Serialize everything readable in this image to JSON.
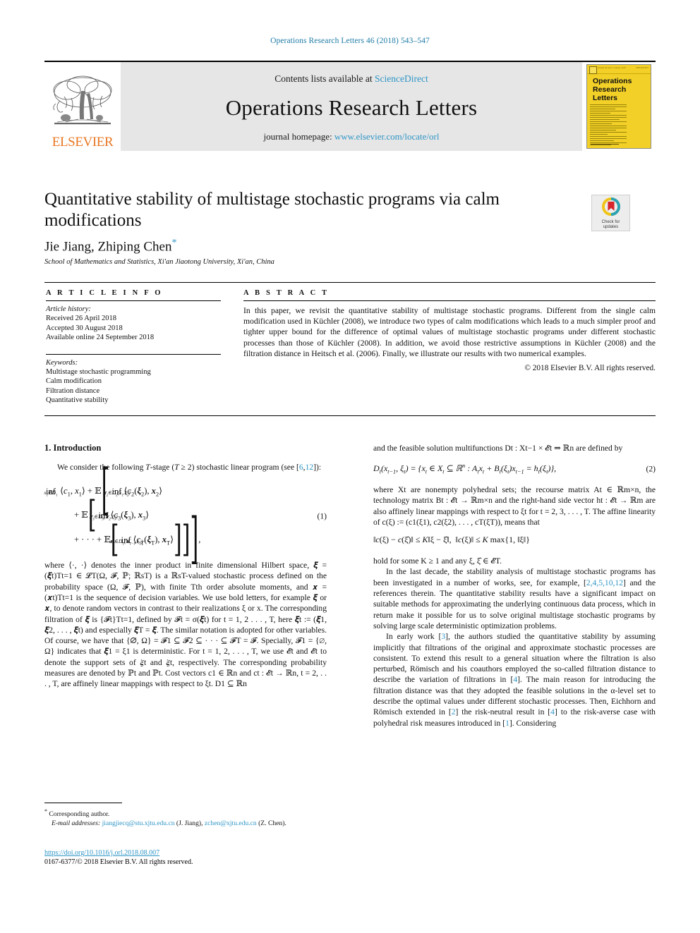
{
  "running_head": "Operations Research Letters 46 (2018) 543–547",
  "masthead": {
    "contents_prefix": "Contents lists available at ",
    "sciencedirect": "ScienceDirect",
    "journal_name": "Operations Research Letters",
    "homepage_prefix": "journal homepage: ",
    "homepage_url": "www.elsevier.com/locate/orl",
    "publisher": "ELSEVIER",
    "publisher_logo": "elsevier-tree-logo",
    "cover": {
      "title_line1": "Operations",
      "title_line2": "Research",
      "title_line3": "Letters",
      "top_left_text": "Volume 46 Issue 5 January 2018",
      "top_right_text": "ISSN 0167-6377",
      "background_color": "#f2d027"
    },
    "accent_link_color": "#2e95c6"
  },
  "crossmark": {
    "line1": "Check for",
    "line2": "updates",
    "icon": "crossmark-icon"
  },
  "article": {
    "title": "Quantitative stability of multistage stochastic programs via calm modifications",
    "authors": "Jie Jiang, Zhiping Chen",
    "corresponding_marker": "*",
    "affiliation": "School of Mathematics and Statistics, Xi'an Jiaotong University, Xi'an, China"
  },
  "info": {
    "heading": "A R T I C L E   I N F O",
    "history_label": "Article history:",
    "history": [
      "Received 26 April 2018",
      "Accepted 30 August 2018",
      "Available online 24 September 2018"
    ],
    "keywords_label": "Keywords:",
    "keywords": [
      "Multistage stochastic programming",
      "Calm modification",
      "Filtration distance",
      "Quantitative stability"
    ]
  },
  "abstract": {
    "heading": "A B S T R A C T",
    "text": "In this paper, we revisit the quantitative stability of multistage stochastic programs. Different from the single calm modification used in Küchler (2008), we introduce two types of calm modifications which leads to a much simpler proof and tighter upper bound for the difference of optimal values of multistage stochastic programs under different stochastic processes than those of Küchler (2008). In addition, we avoid those restrictive assumptions in Küchler (2008) and the filtration distance in Heitsch et al. (2006). Finally, we illustrate our results with two numerical examples.",
    "copyright": "© 2018 Elsevier B.V. All rights reserved."
  },
  "body": {
    "section1_heading": "1. Introduction",
    "left": {
      "p1_a": "We consider the following ",
      "p1_b": "-stage (",
      "p1_c": " ≥ 2) stochastic linear program (see [",
      "p1_ref1": "6",
      "p1_ref2": "12",
      "p1_d": "]):",
      "eq1_number": "(1)",
      "p2": "where ⟨·, ·⟩ denotes the inner product in finite dimensional Hilbert space, 𝝃 = (𝝃t)Tt=1 ∈ 𝓛T(Ω, 𝓕, ℙ; ℝsT) is a ℝsT-valued stochastic process defined on the probability space (Ω, 𝓕, ℙ), with finite Tth order absolute moments, and 𝒙 = (𝒙t)Tt=1 is the sequence of decision variables. We use bold letters, for example 𝝃 or 𝒙, to denote random vectors in contrast to their realizations ξ or x. The corresponding filtration of 𝝃 is {𝓕t}Tt=1, defined by 𝓕t = σ(𝝃t) for t = 1, 2 . . . , T, here 𝝃t := (𝝃1, 𝝃2, . . . , 𝝃t) and especially 𝝃T = 𝝃. The similar notation is adopted for other variables. Of course, we have that {∅, Ω} = 𝓕1 ⊆ 𝓕2 ⊆ · · · ⊆ 𝓕T = 𝓕. Specially, 𝓕1 = {∅, Ω} indicates that 𝝃1 = ξ1 is deterministic. For t = 1, 2, . . . , T, we use 𝓔t and 𝓔t to denote the support sets of 𝝃t and 𝝃t, respectively. The corresponding probability measures are denoted by ℙt and ℙt. Cost vectors c1 ∈ ℝn and ct : 𝓔t → ℝn, t = 2, . . . , T, are affinely linear mappings with respect to ξt. D1 ⊆ ℝn"
    },
    "right": {
      "p1": "and the feasible solution multifunctions Dt : Xt−1 × 𝓔t ⇒ ℝn are defined by",
      "eq2_number": "(2)",
      "p2": "where Xt are nonempty polyhedral sets; the recourse matrix At ∈ ℝm×n, the technology matrix Bt : 𝓔t → ℝm×n and the right-hand side vector ht : 𝓔t → ℝm are also affinely linear mappings with respect to ξt for t = 2, 3, . . . , T. The affine linearity of c(ξ) := (c1(ξ1), c2(ξ2), . . . , cT(ξT)), means that",
      "p3": "hold for some K ≥ 1 and any ξ, ξ̂ ∈ 𝓔T.",
      "p4_a": "In the last decade, the stability analysis of multistage stochastic programs has been investigated in a number of works, see, for example, [",
      "p4_refs": "2,4,5,10,12",
      "p4_b": "] and the references therein. The quantitative stability results have a significant impact on suitable methods for approximating the underlying continuous data process, which in return make it possible for us to solve original multistage stochastic programs by solving large scale deterministic optimization problems.",
      "p5_a": "In early work [",
      "p5_ref1": "3",
      "p5_b": "], the authors studied the quantitative stability by assuming implicitly that filtrations of the original and approximate stochastic processes are consistent. To extend this result to a general situation where the filtration is also perturbed, Römisch and his coauthors employed the so-called filtration distance to describe the variation of filtrations in [",
      "p5_ref2": "4",
      "p5_c": "]. The main reason for introducing the filtration distance was that they adopted the feasible solutions in the α-level set to describe the optimal values under different stochastic processes. Then, Eichhorn and Römisch extended in [",
      "p5_ref3": "2",
      "p5_d": "] the risk-neutral result in [",
      "p5_ref4": "4",
      "p5_e": "] to the risk-averse case with polyhedral risk measures introduced in [",
      "p5_ref5": "1",
      "p5_f": "]. Considering"
    }
  },
  "footnote": {
    "corresponding_star": "*",
    "corresponding_text": " Corresponding author.",
    "email_label": "E-mail addresses:",
    "email1": "jiangjiecq@stu.xjtu.edu.cn",
    "email1_name": " (J. Jiang), ",
    "email2": "zchen@xjtu.edu.cn",
    "email2_name": " (Z. Chen)."
  },
  "footer": {
    "doi": "https://doi.org/10.1016/j.orl.2018.08.007",
    "issn_line": "0167-6377/© 2018 Elsevier B.V. All rights reserved."
  },
  "colors": {
    "link": "#2e95c6",
    "elsevier_orange": "#E87722",
    "cover_yellow": "#f2d027",
    "band_gray": "#e6e6e6"
  }
}
